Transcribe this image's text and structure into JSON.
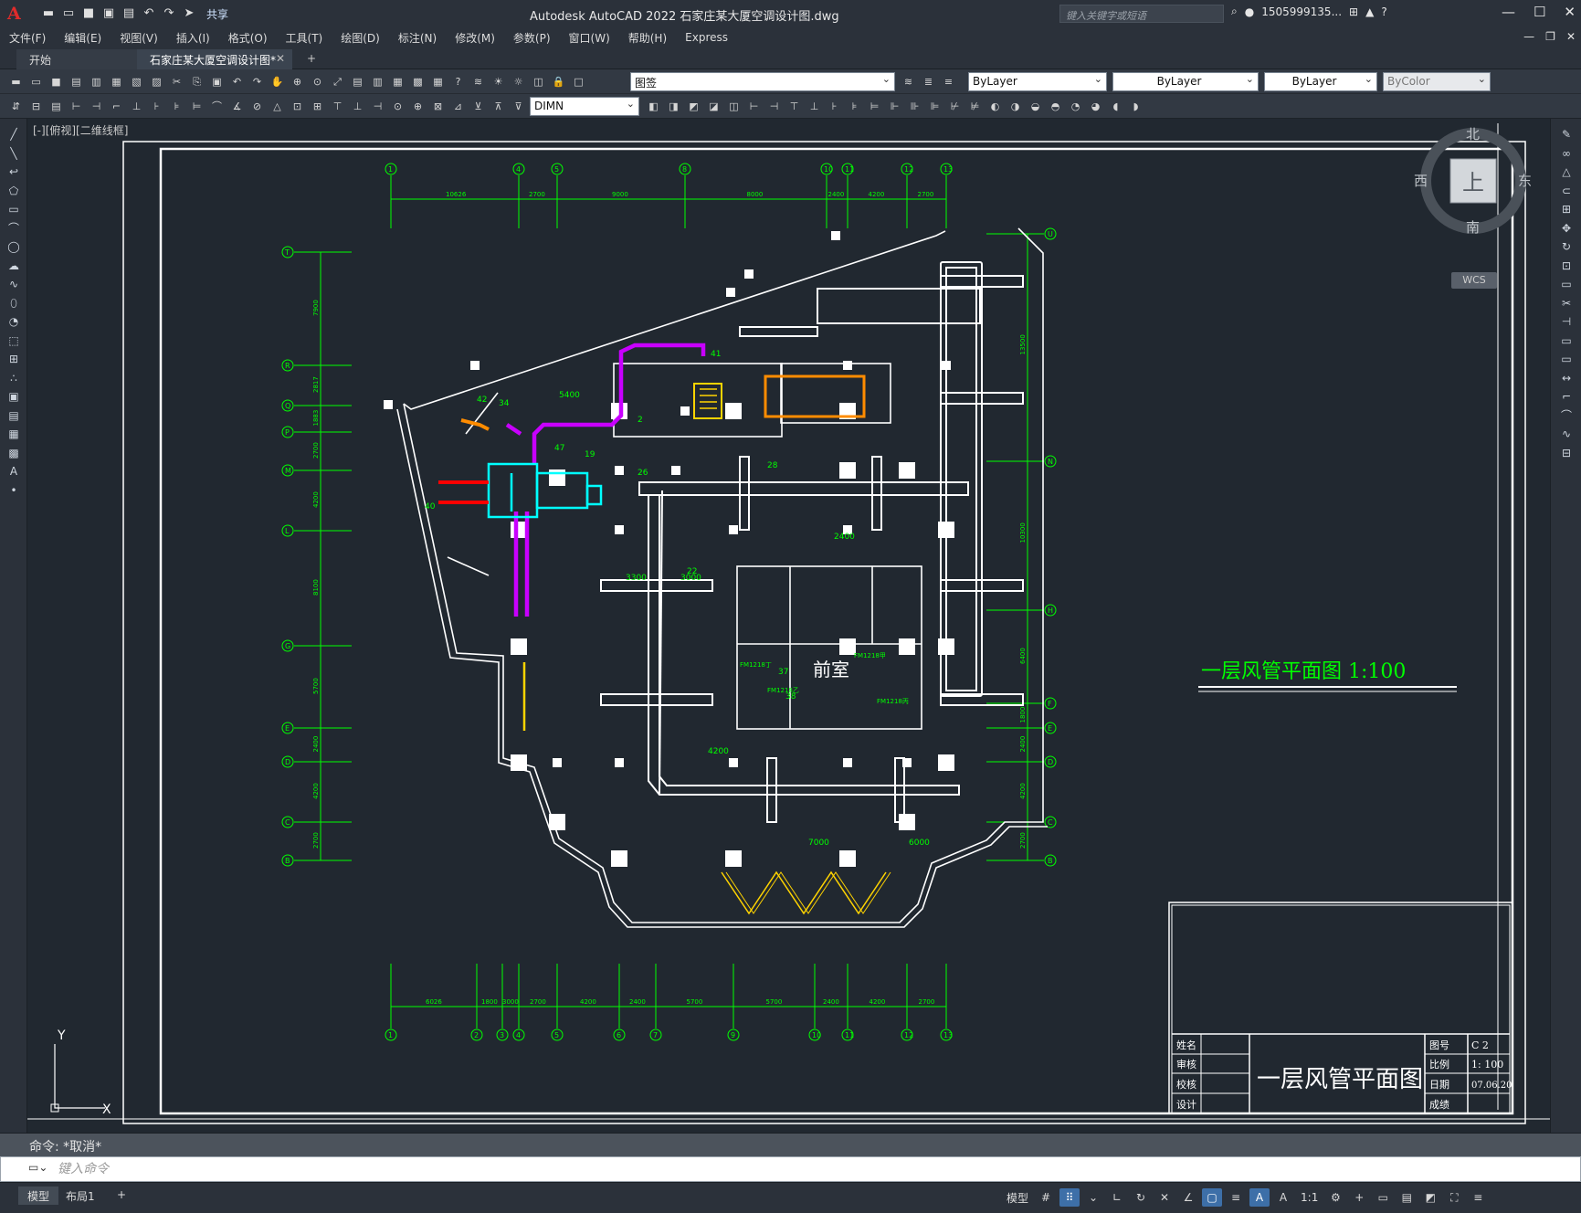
{
  "titlebar": {
    "title": "Autodesk AutoCAD 2022    石家庄某大厦空调设计图.dwg",
    "share_label": "共享",
    "search_placeholder": "键入关键字或短语",
    "user": "1505999135...",
    "logo_letter": "A"
  },
  "menu": {
    "items": [
      "文件(F)",
      "编辑(E)",
      "视图(V)",
      "插入(I)",
      "格式(O)",
      "工具(T)",
      "绘图(D)",
      "标注(N)",
      "修改(M)",
      "参数(P)",
      "窗口(W)",
      "帮助(H)",
      "Express"
    ]
  },
  "tabs": {
    "start": "开始",
    "active": "石家庄某大厦空调设计图*",
    "add": "+"
  },
  "toolbar": {
    "layer_value": "图签",
    "color_value": "ByLayer",
    "linetype_value": "ByLayer",
    "lineweight_value": "ByLayer",
    "plotstyle_value": "ByColor",
    "dimstyle_value": "DIMN"
  },
  "viewport": {
    "label": "[-][俯视][二维线框]",
    "viewcube": {
      "n": "北",
      "s": "南",
      "w": "西",
      "e": "东",
      "top": "上",
      "wcs": "WCS"
    }
  },
  "drawing": {
    "title": "一层风管平面图 1:100",
    "room_label": "前室",
    "top_axes": [
      "1",
      "4",
      "5",
      "8",
      "10",
      "11",
      "12",
      "13"
    ],
    "top_dims": [
      "10626",
      "2700",
      "9000",
      "8000",
      "2400",
      "4200",
      "2700"
    ],
    "bottom_axes": [
      "1",
      "2",
      "3",
      "4",
      "5",
      "6",
      "7",
      "9",
      "10",
      "11",
      "12",
      "13"
    ],
    "bottom_dims": [
      "6026",
      "1800",
      "3000",
      "2700",
      "4200",
      "2400",
      "5700",
      "5700",
      "2400",
      "4200",
      "2700"
    ],
    "left_axes": [
      "T",
      "R",
      "Q",
      "P",
      "M",
      "L",
      "G",
      "E",
      "D",
      "C",
      "B"
    ],
    "left_dims": [
      "7900",
      "2817",
      "1883",
      "2700",
      "4200",
      "8100",
      "5700",
      "2400",
      "4200",
      "2700"
    ],
    "right_axes": [
      "U",
      "N",
      "H",
      "F",
      "E",
      "D",
      "C",
      "B"
    ],
    "right_dims": [
      "13500",
      "10300",
      "6400",
      "1800",
      "2400",
      "4200",
      "2700"
    ],
    "titleblock": {
      "name": "一层风管平面图",
      "labels": [
        "姓名",
        "审核",
        "校核",
        "设计"
      ],
      "fields": [
        [
          "图号",
          "C 2"
        ],
        [
          "比例",
          "1: 100"
        ],
        [
          "日期",
          "07.06.20"
        ],
        [
          "成绩",
          ""
        ]
      ]
    },
    "duct_labels": [
      "41",
      "42",
      "34",
      "47",
      "19",
      "26",
      "28",
      "40",
      "22",
      "37",
      "38",
      "2"
    ],
    "fan_labels": [
      "FM1218甲",
      "FM1218乙",
      "FM1218丙",
      "FM1218丁"
    ],
    "inner_dims": [
      "5400",
      "3300",
      "3000",
      "4200",
      "7000",
      "6000",
      "2400"
    ]
  },
  "command": {
    "history": "命令:  *取消*",
    "placeholder": "键入命令"
  },
  "status": {
    "model": "模型",
    "layout": "布局1",
    "plus": "+",
    "model_btn": "模型",
    "scale": "1:1"
  },
  "colors": {
    "green": "#00ff00",
    "white": "#ffffff",
    "purple": "#c800ff",
    "cyan": "#00ffff",
    "orange": "#ff8c00",
    "yellow": "#ffd400",
    "red": "#ff0000",
    "bg": "#212830"
  }
}
